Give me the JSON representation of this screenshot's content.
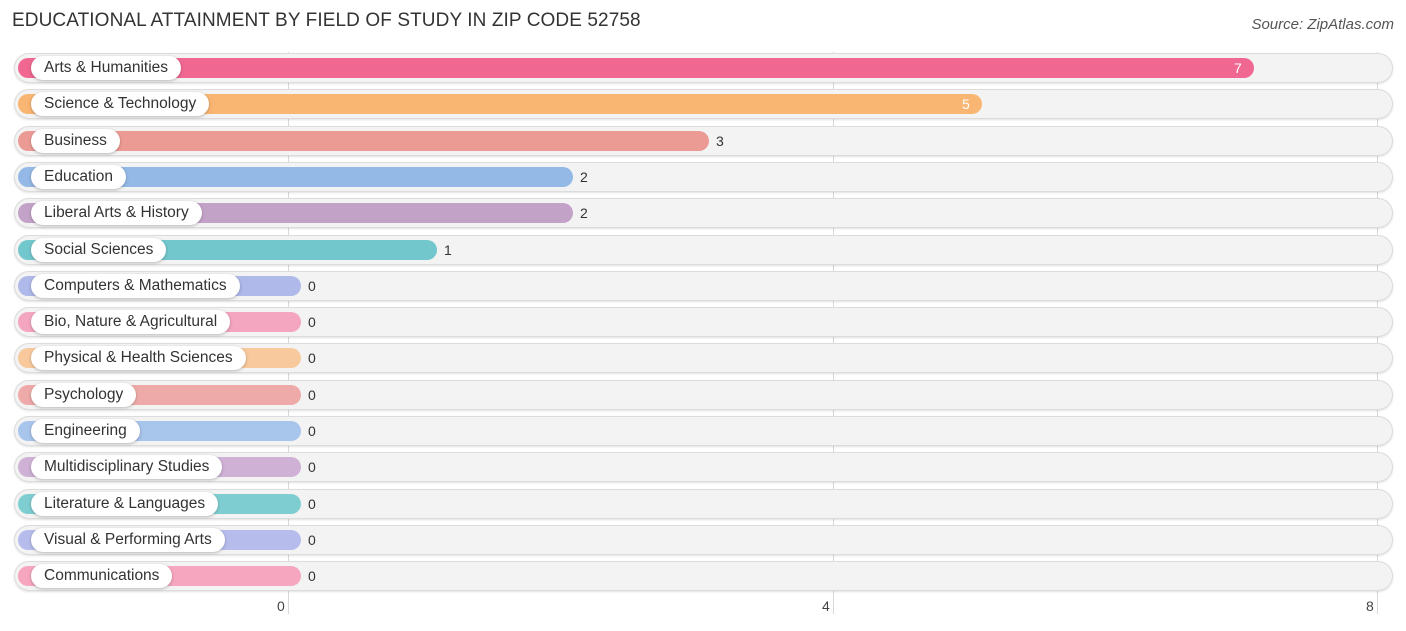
{
  "header": {
    "title": "EDUCATIONAL ATTAINMENT BY FIELD OF STUDY IN ZIP CODE 52758",
    "source": "Source: ZipAtlas.com"
  },
  "chart_data": {
    "type": "bar",
    "orientation": "horizontal",
    "title": "EDUCATIONAL ATTAINMENT BY FIELD OF STUDY IN ZIP CODE 52758",
    "xlabel": "",
    "ylabel": "",
    "xlim": [
      0,
      8
    ],
    "xticks": [
      0,
      4,
      8
    ],
    "grid": true,
    "categories": [
      "Arts & Humanities",
      "Science & Technology",
      "Business",
      "Education",
      "Liberal Arts & History",
      "Social Sciences",
      "Computers & Mathematics",
      "Bio, Nature & Agricultural",
      "Physical & Health Sciences",
      "Psychology",
      "Engineering",
      "Multidisciplinary Studies",
      "Literature & Languages",
      "Visual & Performing Arts",
      "Communications"
    ],
    "values": [
      7,
      5,
      3,
      2,
      2,
      1,
      0,
      0,
      0,
      0,
      0,
      0,
      0,
      0,
      0
    ],
    "colors": [
      "#f06891",
      "#f9b572",
      "#ec9b94",
      "#94b9e6",
      "#c3a2c8",
      "#72c7cd",
      "#afb9ea",
      "#f4a5bf",
      "#f8c99c",
      "#eeaaa8",
      "#a8c5eb",
      "#cfb1d5",
      "#7ecdd1",
      "#b6bdec",
      "#f6a6be"
    ]
  }
}
